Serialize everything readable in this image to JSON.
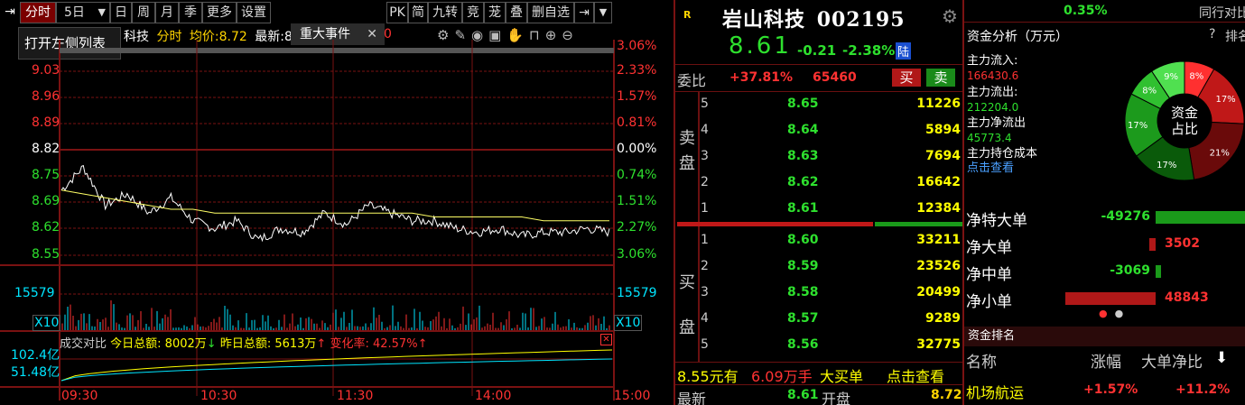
{
  "toolbar": {
    "left_items": [
      "分时",
      "5日",
      "日",
      "周",
      "月",
      "季",
      "更多",
      "设置"
    ],
    "right_items": [
      "PK",
      "简",
      "九转",
      "竞",
      "茏",
      "叠",
      "删自选"
    ],
    "active": "分时",
    "pin_icon": "pin-icon",
    "dropdown_icon": "chevron-down-icon"
  },
  "tooltip": "打开左侧列表",
  "popup": {
    "label": "重大事件",
    "close": "✕"
  },
  "info_bar": {
    "name_tail": "科技",
    "mode": "分时",
    "avg_label": "均价:",
    "avg_value": "8.72",
    "last_label": "最新:",
    "last_value": "8",
    "tail_digit": "0"
  },
  "chart_icons": [
    "settings-icon",
    "pen-icon",
    "eye-icon",
    "box-icon",
    "hand-icon",
    "lock-icon",
    "zoom-in-icon",
    "zoom-out-icon"
  ],
  "chart": {
    "y_left": [
      "9.03",
      "8.96",
      "8.89",
      "8.82",
      "8.75",
      "8.69",
      "8.62",
      "8.55"
    ],
    "y_right": [
      "3.06%",
      "2.33%",
      "1.57%",
      "0.81%",
      "0.00%",
      "0.74%",
      "1.51%",
      "2.27%",
      "3.06%"
    ],
    "vol_label_left": "15579",
    "vol_label_right": "15579",
    "vol_mult_left": "X10",
    "vol_mult_right": "X10",
    "compare_bar": {
      "label": "成交对比",
      "today": "今日总额: 8002万",
      "today_arrow": "↓",
      "yesterday": "昨日总额: 5613万",
      "yesterday_arrow": "↑",
      "change": "变化率: 42.57%",
      "change_arrow": "↑",
      "close": "✕"
    },
    "amount_left": [
      "102.4亿",
      "51.48亿"
    ],
    "x_ticks": [
      "09:30",
      "10:30",
      "11:30",
      "14:00",
      "15:00"
    ]
  },
  "chart_data": {
    "type": "line",
    "x": [
      "09:30",
      "10:30",
      "11:30",
      "14:00",
      "15:00"
    ],
    "xlabel": "",
    "ylabel": "",
    "ylim": [
      8.55,
      9.03
    ],
    "series": [
      {
        "values": [
          8.72,
          8.78,
          8.68,
          8.71,
          8.66,
          8.7,
          8.64,
          8.62,
          8.64,
          8.59,
          8.62,
          8.61,
          8.66,
          8.63,
          8.68,
          8.66,
          8.64,
          8.64,
          8.62,
          8.61,
          8.62,
          8.6,
          8.61,
          8.61,
          8.62,
          8.61
        ]
      },
      {
        "values": [
          8.72,
          8.71,
          8.7,
          8.69,
          8.68,
          8.67,
          8.67,
          8.66,
          8.66,
          8.66,
          8.66,
          8.66,
          8.66,
          8.66,
          8.66,
          8.66,
          8.66,
          8.65,
          8.65,
          8.65,
          8.65,
          8.65,
          8.64,
          8.64,
          8.64,
          8.64
        ]
      }
    ]
  },
  "stock": {
    "market_tag": "R",
    "name": "岩山科技",
    "code": "002195",
    "price": "8.61",
    "change": "-0.21",
    "change_pct": "-2.38%",
    "badge": "陆",
    "gear_icon": "gear-icon"
  },
  "weibi": {
    "label": "委比",
    "pct": "+37.81%",
    "value": "65460",
    "buy_btn": "买",
    "sell_btn": "卖"
  },
  "sell_label": [
    "卖",
    "盘"
  ],
  "buy_label": [
    "买",
    "盘"
  ],
  "asks": [
    {
      "level": "5",
      "price": "8.65",
      "vol": "11226"
    },
    {
      "level": "4",
      "price": "8.64",
      "vol": "5894"
    },
    {
      "level": "3",
      "price": "8.63",
      "vol": "7694"
    },
    {
      "level": "2",
      "price": "8.62",
      "vol": "16642"
    },
    {
      "level": "1",
      "price": "8.61",
      "vol": "12384"
    }
  ],
  "bids": [
    {
      "level": "1",
      "price": "8.60",
      "vol": "33211"
    },
    {
      "level": "2",
      "price": "8.59",
      "vol": "23526"
    },
    {
      "level": "3",
      "price": "8.58",
      "vol": "20499"
    },
    {
      "level": "4",
      "price": "8.57",
      "vol": "9289"
    },
    {
      "level": "5",
      "price": "8.56",
      "vol": "32775"
    }
  ],
  "big_order": {
    "price": "8.55元有",
    "amount": "6.09万手",
    "type": "大买单",
    "link": "点击查看"
  },
  "bottom_row": {
    "label1": "最新",
    "v1": "8.61",
    "label2": "开盘",
    "v2": "8.72"
  },
  "right_panel": {
    "top_pct": "0.35%",
    "top_right": "同行对比",
    "title": "资金分析（万元）",
    "help": "?",
    "rank_label": "排名",
    "inflow_label": "主力流入:",
    "inflow": "166430.6",
    "outflow_label": "主力流出:",
    "outflow": "212204.0",
    "net_label": "主力净流出",
    "net": "45773.4",
    "cost_label": "主力持仓成本",
    "cost_link": "点击查看",
    "donut_center": [
      "资金",
      "占比"
    ],
    "donut": [
      {
        "label": "8%",
        "value": 8,
        "color": "#ff3030"
      },
      {
        "label": "17%",
        "value": 17,
        "color": "#c01818"
      },
      {
        "label": "21%",
        "value": 21,
        "color": "#6a0a0a"
      },
      {
        "label": "17%",
        "value": 17,
        "color": "#0a5a0a"
      },
      {
        "label": "17%",
        "value": 17,
        "color": "#1c9a1c"
      },
      {
        "label": "8%",
        "value": 8,
        "color": "#30c030"
      },
      {
        "label": "9%",
        "value": 9,
        "color": "#50e050"
      }
    ],
    "flows": [
      {
        "label": "净特大单",
        "value": "-49276",
        "color": "#2ee02e",
        "bar": 1.0,
        "side": "green"
      },
      {
        "label": "净大单",
        "value": "3502",
        "color": "#ff3232",
        "bar": 0.07,
        "side": "red"
      },
      {
        "label": "净中单",
        "value": "-3069",
        "color": "#2ee02e",
        "bar": 0.06,
        "side": "green"
      },
      {
        "label": "净小单",
        "value": "48843",
        "color": "#ff3232",
        "bar": 1.0,
        "side": "red"
      }
    ],
    "rank_title": "资金排名",
    "rank_headers": [
      "名称",
      "涨幅",
      "大单净比"
    ],
    "rank_sort_icon": "sort-down-icon",
    "rank_rows": [
      {
        "name": "机场航运",
        "chg": "+1.57%",
        "net": "+11.2%"
      }
    ]
  },
  "colors": {
    "up": "#ff3232",
    "down": "#2ee02e",
    "yellow": "#ffff00",
    "cyan": "#00e5ff",
    "grid": "#7a1212"
  }
}
